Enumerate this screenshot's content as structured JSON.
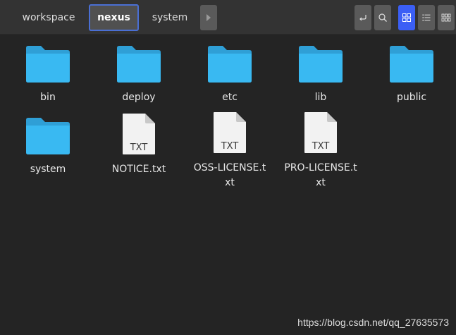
{
  "breadcrumbs": [
    {
      "label": "workspace",
      "active": false
    },
    {
      "label": "nexus",
      "active": true
    },
    {
      "label": "system",
      "active": false
    }
  ],
  "toolbar": {
    "more_icon": "triangle-right-icon",
    "back_icon": "return-arrow-icon",
    "search_icon": "search-icon",
    "view_grid_icon": "grid-view-icon",
    "view_list_icon": "list-view-icon",
    "view_compact_icon": "compact-view-icon",
    "active_view": "grid"
  },
  "items": [
    {
      "name": "bin",
      "type": "folder"
    },
    {
      "name": "deploy",
      "type": "folder"
    },
    {
      "name": "etc",
      "type": "folder"
    },
    {
      "name": "lib",
      "type": "folder"
    },
    {
      "name": "public",
      "type": "folder"
    },
    {
      "name": "system",
      "type": "folder"
    },
    {
      "name": "NOTICE.txt",
      "type": "file",
      "badge": "TXT"
    },
    {
      "name": "OSS-LICENSE.txt",
      "type": "file",
      "badge": "TXT"
    },
    {
      "name": "PRO-LICENSE.txt",
      "type": "file",
      "badge": "TXT"
    }
  ],
  "colors": {
    "folder": "#39b9f2",
    "folder_tab": "#2f9fd6",
    "accent": "#3b5ff5",
    "active_border": "#4a6fd4"
  },
  "watermark": "https://blog.csdn.net/qq_27635573"
}
